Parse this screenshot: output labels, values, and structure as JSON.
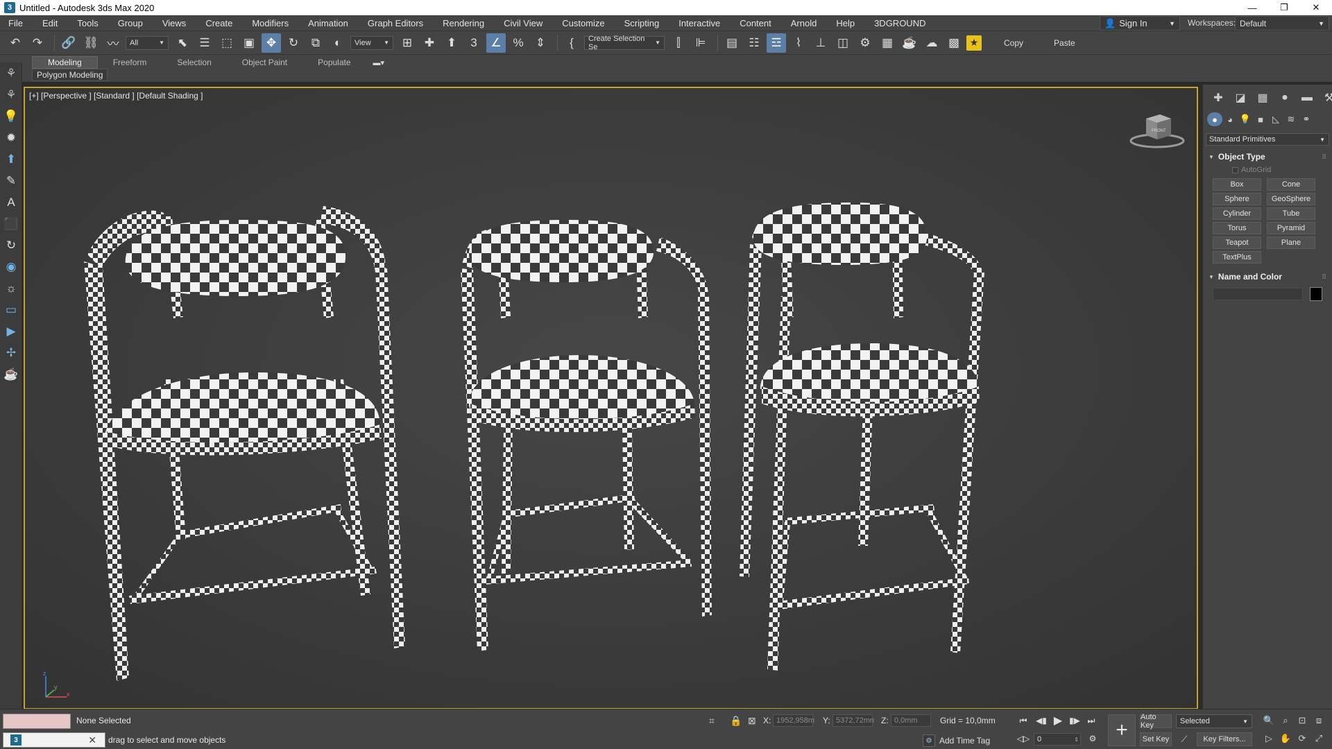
{
  "window": {
    "title": "Untitled - Autodesk 3ds Max 2020",
    "app_icon": "3",
    "controls": [
      "—",
      "❐",
      "✕"
    ]
  },
  "menu": {
    "items": [
      "File",
      "Edit",
      "Tools",
      "Group",
      "Views",
      "Create",
      "Modifiers",
      "Animation",
      "Graph Editors",
      "Rendering",
      "Civil View",
      "Customize",
      "Scripting",
      "Interactive",
      "Content",
      "Arnold",
      "Help",
      "3DGROUND"
    ],
    "sign_in": "Sign In",
    "workspaces_label": "Workspaces:",
    "workspace_value": "Default"
  },
  "toolbar": {
    "selection_filter": "All",
    "ref_coord": "View",
    "named_selection": "Create Selection Se",
    "copy_label": "Copy",
    "paste_label": "Paste"
  },
  "ribbon": {
    "tabs": [
      "Modeling",
      "Freeform",
      "Selection",
      "Object Paint",
      "Populate"
    ],
    "active_tab": "Modeling",
    "subtab": "Polygon Modeling"
  },
  "viewport": {
    "label": "[+] [Perspective ] [Standard ] [Default Shading ]",
    "border_color": "#c8a22a",
    "viewcube_face": "FRONT",
    "axis": {
      "x": "x",
      "y": "y",
      "z": "z"
    }
  },
  "command_panel": {
    "category_dropdown": "Standard Primitives",
    "object_type_title": "Object Type",
    "autogrid_label": "AutoGrid",
    "primitives": [
      "Box",
      "Cone",
      "Sphere",
      "GeoSphere",
      "Cylinder",
      "Tube",
      "Torus",
      "Pyramid",
      "Teapot",
      "Plane",
      "TextPlus"
    ],
    "name_color_title": "Name and Color",
    "object_color": "#000000"
  },
  "status": {
    "selection": "None Selected",
    "prompt": "drag to select and move objects",
    "x_label": "X:",
    "x_value": "1952,958m",
    "y_label": "Y:",
    "y_value": "5372,72mn",
    "z_label": "Z:",
    "z_value": "0,0mm",
    "grid": "Grid = 10,0mm",
    "add_time_tag": "Add Time Tag",
    "frame": "0",
    "auto_key": "Auto Key",
    "set_key": "Set Key",
    "key_mode": "Selected",
    "key_filters": "Key Filters..."
  }
}
